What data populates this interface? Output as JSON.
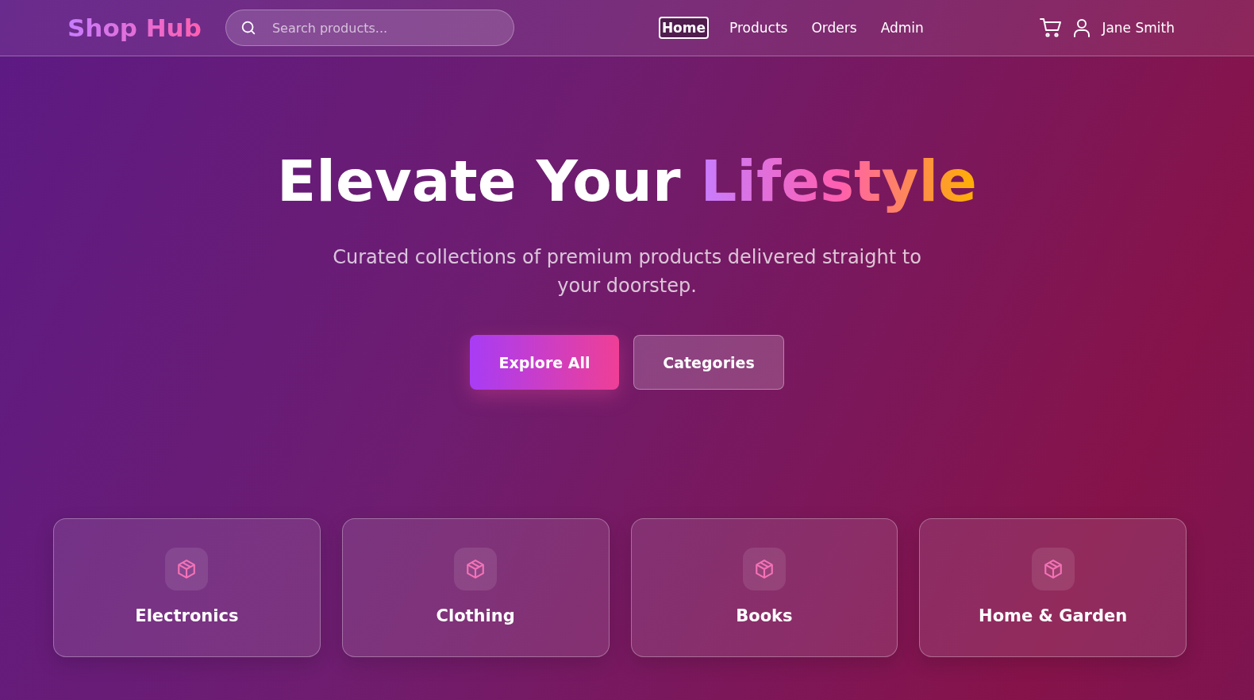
{
  "header": {
    "logo": "Shop Hub",
    "search": {
      "placeholder": "Search products..."
    },
    "nav": [
      {
        "label": "Home",
        "selected": true
      },
      {
        "label": "Products",
        "selected": false
      },
      {
        "label": "Orders",
        "selected": false
      },
      {
        "label": "Admin",
        "selected": false
      }
    ],
    "user": "Jane Smith"
  },
  "hero": {
    "title": {
      "lead": "Elevate Your",
      "accent": "Lifestyle"
    },
    "subtitle": "Curated collections of premium products delivered straight to your doorstep.",
    "buttons": [
      {
        "label": "Explore All",
        "kind": "primary"
      },
      {
        "label": "Categories",
        "kind": "secondary"
      }
    ]
  },
  "categories": [
    {
      "name": "Electronics"
    },
    {
      "name": "Clothing"
    },
    {
      "name": "Books"
    },
    {
      "name": "Home & Garden"
    }
  ]
}
